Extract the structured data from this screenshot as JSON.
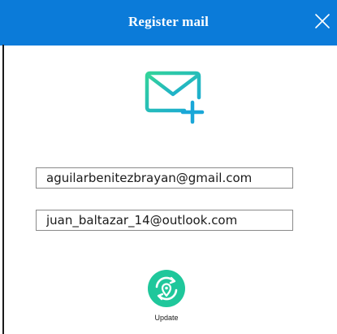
{
  "window": {
    "title": "Register mail",
    "close_icon": "close-icon",
    "titlebar_color": "#0b7bd9"
  },
  "main": {
    "header_icon": "mail-add-icon",
    "emails": [
      {
        "value": "aguilarbenitezbrayan@gmail.com"
      },
      {
        "value": "juan_baltazar_14@outlook.com"
      }
    ],
    "update_button": {
      "icon": "sync-location-icon",
      "label": "Update",
      "color": "#1fc79b"
    }
  }
}
